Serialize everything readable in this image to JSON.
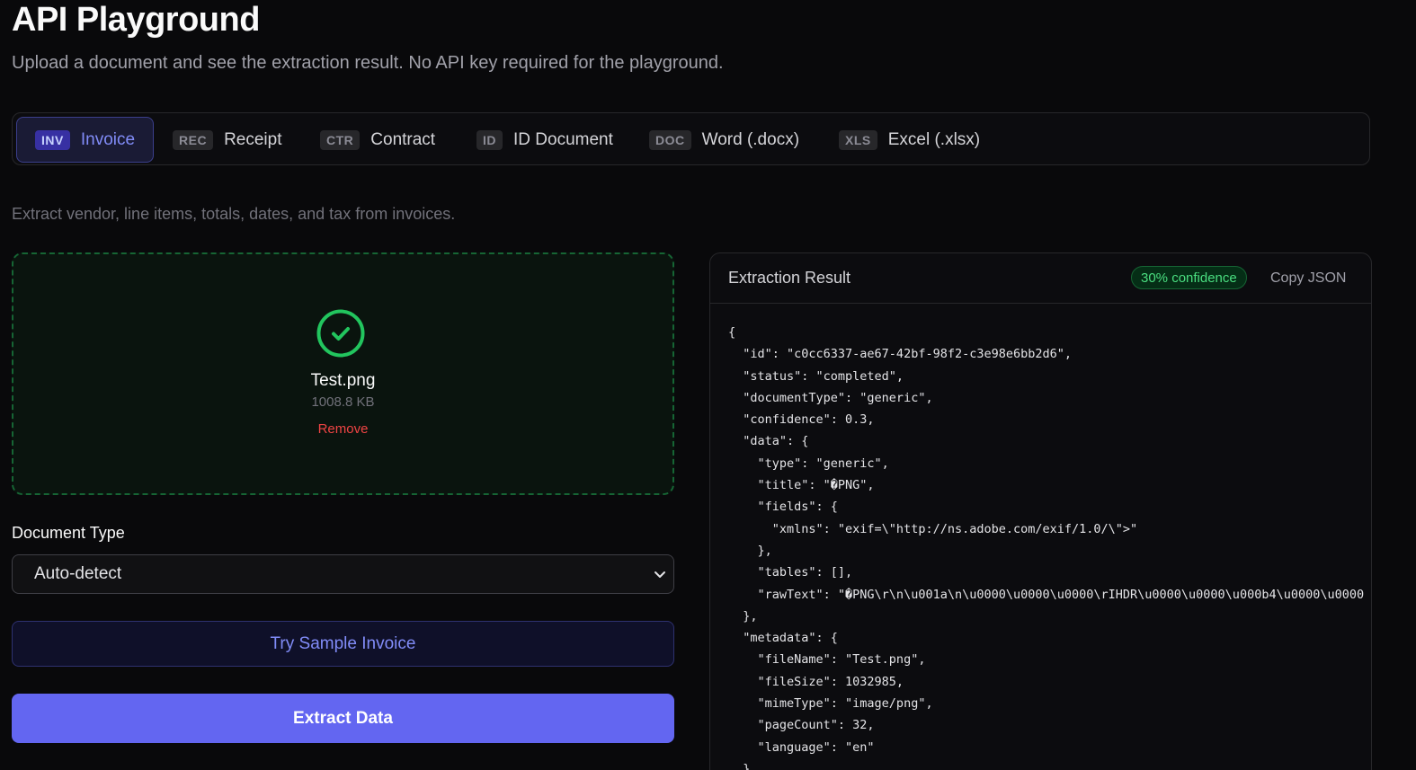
{
  "header": {
    "title": "API Playground",
    "subtitle": "Upload a document and see the extraction result. No API key required for the playground."
  },
  "tabs": [
    {
      "code": "INV",
      "label": "Invoice",
      "active": true
    },
    {
      "code": "REC",
      "label": "Receipt",
      "active": false
    },
    {
      "code": "CTR",
      "label": "Contract",
      "active": false
    },
    {
      "code": "ID",
      "label": "ID Document",
      "active": false
    },
    {
      "code": "DOC",
      "label": "Word (.docx)",
      "active": false
    },
    {
      "code": "XLS",
      "label": "Excel (.xlsx)",
      "active": false
    }
  ],
  "description": "Extract vendor, line items, totals, dates, and tax from invoices.",
  "upload": {
    "file_name": "Test.png",
    "file_size": "1008.8 KB",
    "remove_label": "Remove",
    "icon": "check-circle-icon"
  },
  "document_type": {
    "label": "Document Type",
    "selected": "Auto-detect"
  },
  "buttons": {
    "sample": "Try Sample Invoice",
    "extract": "Extract Data"
  },
  "result": {
    "title": "Extraction Result",
    "confidence": "30% confidence",
    "copy": "Copy JSON",
    "json_lines": [
      "{",
      "  \"id\": \"c0cc6337-ae67-42bf-98f2-c3e98e6bb2d6\",",
      "  \"status\": \"completed\",",
      "  \"documentType\": \"generic\",",
      "  \"confidence\": 0.3,",
      "  \"data\": {",
      "    \"type\": \"generic\",",
      "    \"title\": \"�PNG\",",
      "    \"fields\": {",
      "      \"xmlns\": \"exif=\\\"http://ns.adobe.com/exif/1.0/\\\">\"",
      "    },",
      "    \"tables\": [],",
      "    \"rawText\": \"�PNG\\r\\n\\u001a\\n\\u0000\\u0000\\u0000\\rIHDR\\u0000\\u0000\\u000b4\\u0000\\u0000",
      "  },",
      "  \"metadata\": {",
      "    \"fileName\": \"Test.png\",",
      "    \"fileSize\": 1032985,",
      "    \"mimeType\": \"image/png\",",
      "    \"pageCount\": 32,",
      "    \"language\": \"en\"",
      "  },"
    ]
  },
  "colors": {
    "accent": "#6366f1",
    "success": "#22c55e",
    "danger": "#ef4444",
    "background": "#09090b"
  }
}
